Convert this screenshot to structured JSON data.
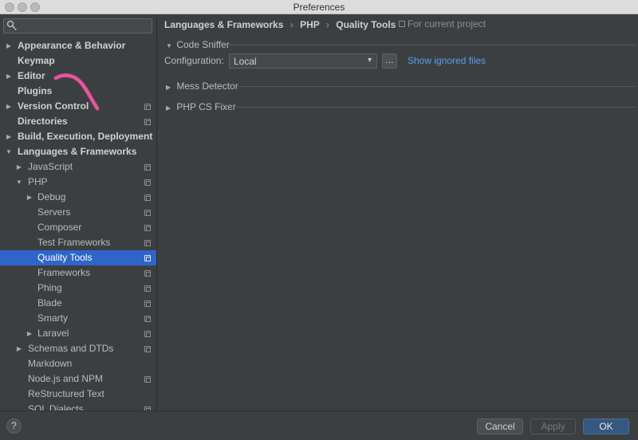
{
  "window": {
    "title": "Preferences"
  },
  "search": {
    "placeholder": ""
  },
  "tree": [
    {
      "label": "Appearance & Behavior",
      "depth": 0,
      "arrow": "▶",
      "bold": true,
      "project": false,
      "selected": false
    },
    {
      "label": "Keymap",
      "depth": 0,
      "arrow": "",
      "bold": true,
      "project": false,
      "selected": false
    },
    {
      "label": "Editor",
      "depth": 0,
      "arrow": "▶",
      "bold": true,
      "project": false,
      "selected": false
    },
    {
      "label": "Plugins",
      "depth": 0,
      "arrow": "",
      "bold": true,
      "project": false,
      "selected": false
    },
    {
      "label": "Version Control",
      "depth": 0,
      "arrow": "▶",
      "bold": true,
      "project": true,
      "selected": false
    },
    {
      "label": "Directories",
      "depth": 0,
      "arrow": "",
      "bold": true,
      "project": true,
      "selected": false
    },
    {
      "label": "Build, Execution, Deployment",
      "depth": 0,
      "arrow": "▶",
      "bold": true,
      "project": false,
      "selected": false
    },
    {
      "label": "Languages & Frameworks",
      "depth": 0,
      "arrow": "▼",
      "bold": true,
      "project": false,
      "selected": false
    },
    {
      "label": "JavaScript",
      "depth": 1,
      "arrow": "▶",
      "bold": false,
      "project": true,
      "selected": false
    },
    {
      "label": "PHP",
      "depth": 1,
      "arrow": "▼",
      "bold": false,
      "project": true,
      "selected": false
    },
    {
      "label": "Debug",
      "depth": 2,
      "arrow": "▶",
      "bold": false,
      "project": true,
      "selected": false
    },
    {
      "label": "Servers",
      "depth": 2,
      "arrow": "",
      "bold": false,
      "project": true,
      "selected": false
    },
    {
      "label": "Composer",
      "depth": 2,
      "arrow": "",
      "bold": false,
      "project": true,
      "selected": false
    },
    {
      "label": "Test Frameworks",
      "depth": 2,
      "arrow": "",
      "bold": false,
      "project": true,
      "selected": false
    },
    {
      "label": "Quality Tools",
      "depth": 2,
      "arrow": "",
      "bold": false,
      "project": true,
      "selected": true
    },
    {
      "label": "Frameworks",
      "depth": 2,
      "arrow": "",
      "bold": false,
      "project": true,
      "selected": false
    },
    {
      "label": "Phing",
      "depth": 2,
      "arrow": "",
      "bold": false,
      "project": true,
      "selected": false
    },
    {
      "label": "Blade",
      "depth": 2,
      "arrow": "",
      "bold": false,
      "project": true,
      "selected": false
    },
    {
      "label": "Smarty",
      "depth": 2,
      "arrow": "",
      "bold": false,
      "project": true,
      "selected": false
    },
    {
      "label": "Laravel",
      "depth": 2,
      "arrow": "▶",
      "bold": false,
      "project": true,
      "selected": false
    },
    {
      "label": "Schemas and DTDs",
      "depth": 1,
      "arrow": "▶",
      "bold": false,
      "project": true,
      "selected": false
    },
    {
      "label": "Markdown",
      "depth": 1,
      "arrow": "",
      "bold": false,
      "project": false,
      "selected": false
    },
    {
      "label": "Node.js and NPM",
      "depth": 1,
      "arrow": "",
      "bold": false,
      "project": true,
      "selected": false
    },
    {
      "label": "ReStructured Text",
      "depth": 1,
      "arrow": "",
      "bold": false,
      "project": false,
      "selected": false
    },
    {
      "label": "SQL Dialects",
      "depth": 1,
      "arrow": "",
      "bold": false,
      "project": true,
      "selected": false
    }
  ],
  "breadcrumb": {
    "item1": "Languages & Frameworks",
    "sep1": "›",
    "item2": "PHP",
    "sep2": "›",
    "item3": "Quality Tools"
  },
  "scope_label": "For current project",
  "sections": {
    "code_sniffer": {
      "label": "Code Sniffer",
      "arrow": "▼"
    },
    "mess_detector": {
      "label": "Mess Detector",
      "arrow": "▶"
    },
    "php_cs_fixer": {
      "label": "PHP CS Fixer",
      "arrow": "▶"
    }
  },
  "configuration": {
    "label": "Configuration:",
    "value": "Local",
    "dropdown_arrow": "▼",
    "browse_label": "...",
    "link": "Show ignored files"
  },
  "footer": {
    "help": "?",
    "cancel": "Cancel",
    "apply": "Apply",
    "ok": "OK"
  },
  "colors": {
    "selection": "#2f65ca",
    "link": "#589df6",
    "ok_button": "#365880",
    "background": "#3c3f41"
  }
}
